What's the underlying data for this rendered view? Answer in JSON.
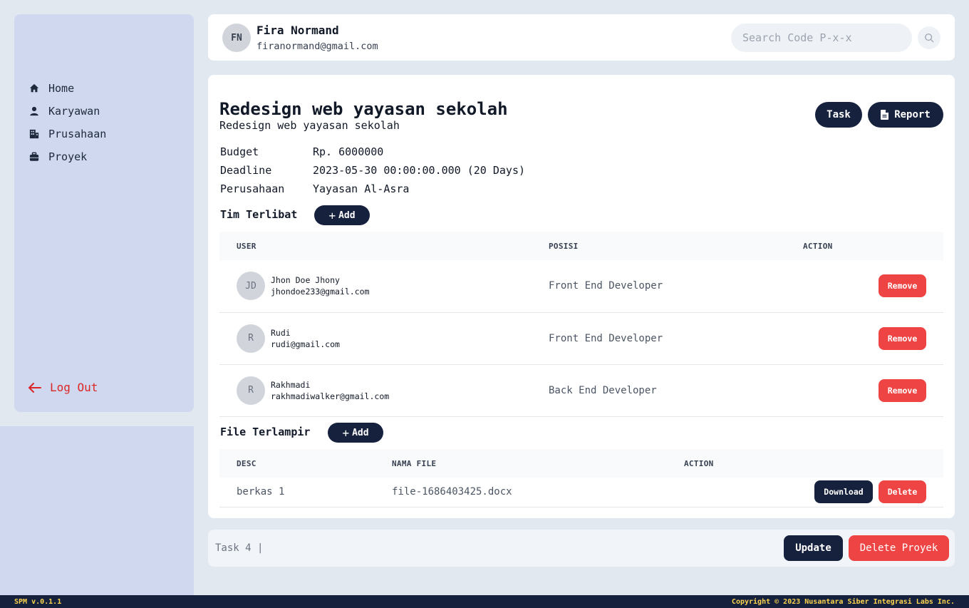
{
  "sidebar": {
    "items": [
      {
        "label": "Home",
        "icon": "home-icon"
      },
      {
        "label": "Karyawan",
        "icon": "user-icon"
      },
      {
        "label": "Prusahaan",
        "icon": "building-icon"
      },
      {
        "label": "Proyek",
        "icon": "briefcase-icon"
      }
    ],
    "logout_label": "Log Out"
  },
  "header": {
    "initials": "FN",
    "name": "Fira Normand",
    "email": "firanormand@gmail.com",
    "search_placeholder": "Search Code P-x-x"
  },
  "project": {
    "title": "Redesign web yayasan sekolah",
    "subtitle": "Redesign web yayasan sekolah",
    "task_label": "Task",
    "report_label": "Report",
    "info": [
      {
        "label": "Budget",
        "value": "Rp. 6000000"
      },
      {
        "label": "Deadline",
        "value": "2023-05-30 00:00:00.000 (20 Days)"
      },
      {
        "label": "Perusahaan",
        "value": "Yayasan Al-Asra"
      }
    ]
  },
  "team": {
    "title": "Tim Terlibat",
    "add_label": "Add",
    "headers": [
      "USER",
      "POSISI",
      "ACTION"
    ],
    "rows": [
      {
        "initials": "JD",
        "name": "Jhon Doe Jhony",
        "email": "jhondoe233@gmail.com",
        "position": "Front End Developer",
        "action": "Remove"
      },
      {
        "initials": "R",
        "name": "Rudi",
        "email": "rudi@gmail.com",
        "position": "Front End Developer",
        "action": "Remove"
      },
      {
        "initials": "R",
        "name": "Rakhmadi",
        "email": "rakhmadiwalker@gmail.com",
        "position": "Back End Developer",
        "action": "Remove"
      }
    ]
  },
  "files": {
    "title": "File Terlampir",
    "add_label": "Add",
    "headers": [
      "DESC",
      "NAMA FILE",
      "ACTION"
    ],
    "rows": [
      {
        "desc": "berkas 1",
        "filename": "file-1686403425.docx",
        "download": "Download",
        "delete": "Delete"
      }
    ]
  },
  "bottom": {
    "status": "Task 4 |",
    "update_label": "Update",
    "delete_label": "Delete Proyek"
  },
  "footer": {
    "version": "SPM v.0.1.1",
    "copyright": "Copyright © 2023 Nusantara Siber Integrasi Labs Inc."
  },
  "colors": {
    "primary": "#16213e",
    "danger": "#ef4444",
    "sidebar": "#cfd8ef",
    "background": "#e2e8f0",
    "footer_text": "#fcd34d"
  }
}
